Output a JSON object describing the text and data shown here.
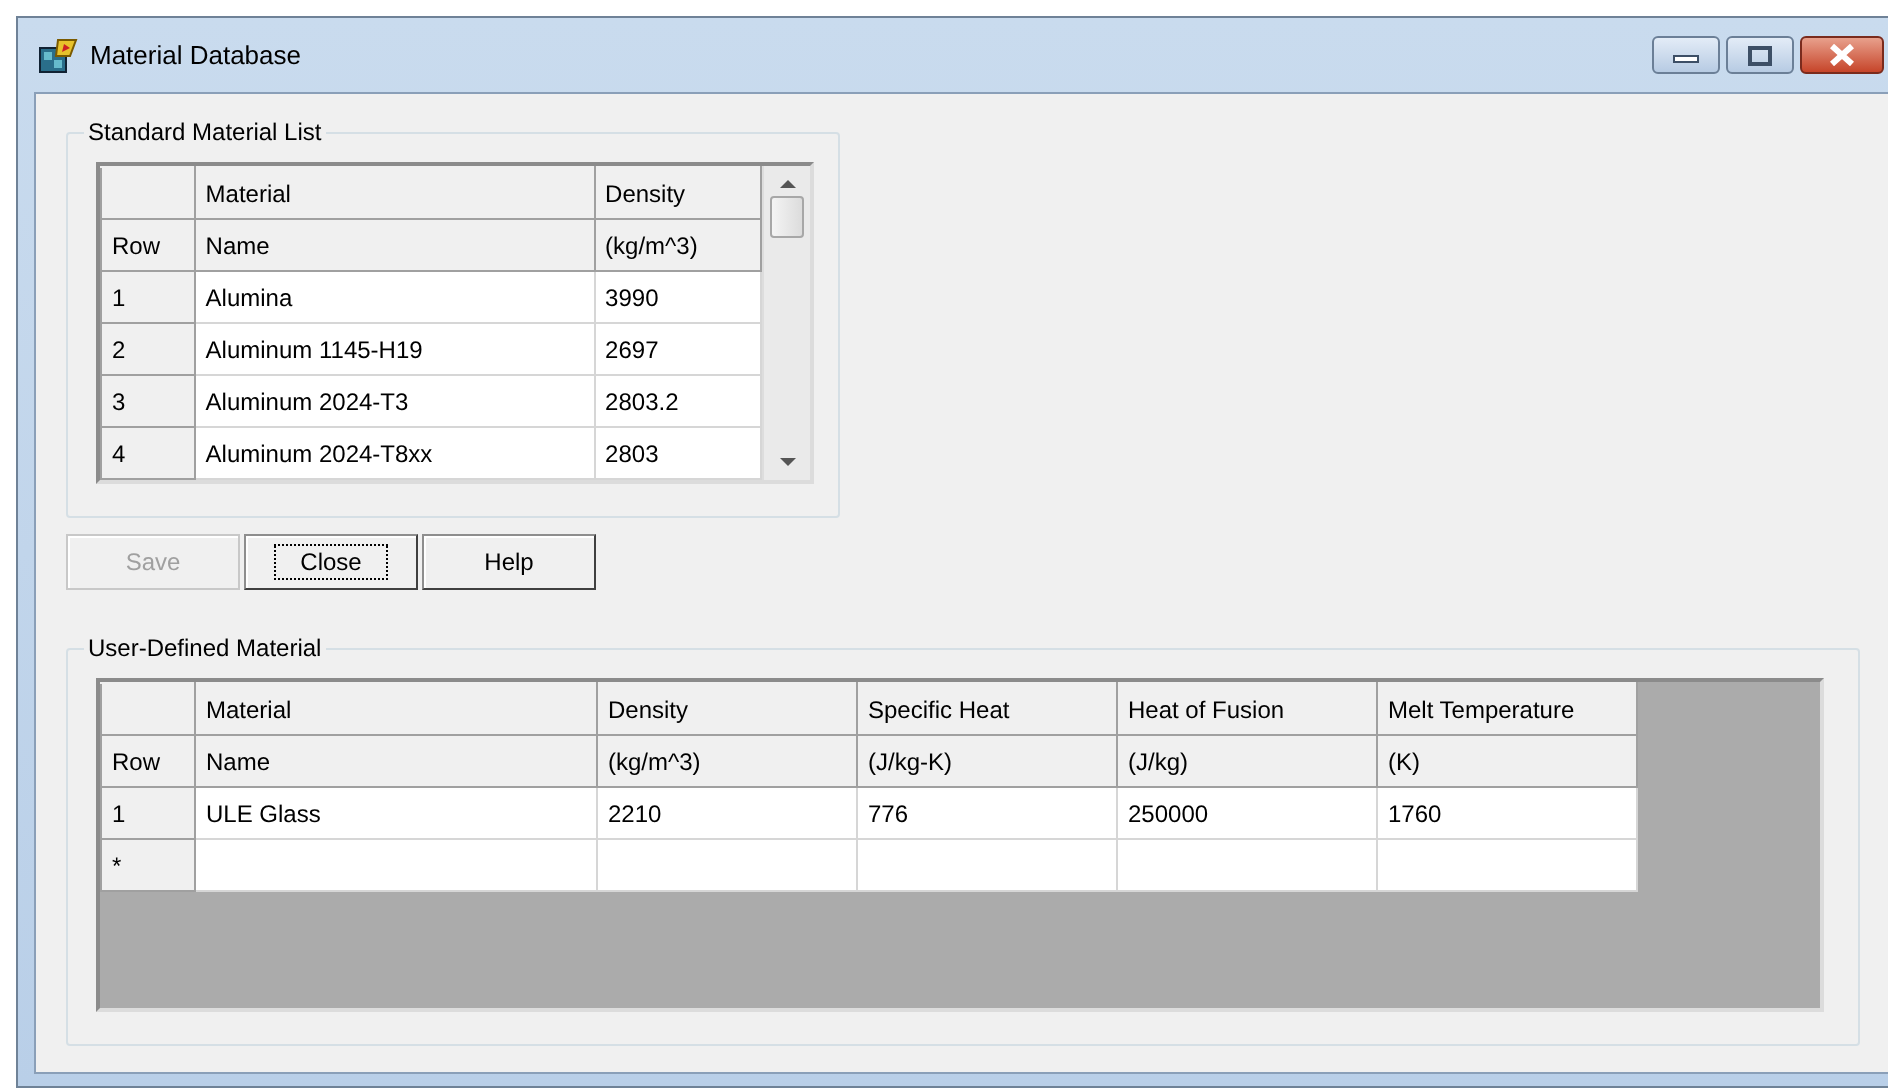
{
  "window": {
    "title": "Material Database"
  },
  "standard_list": {
    "legend": "Standard Material List",
    "header_rows": [
      [
        "",
        "Material",
        "Density"
      ],
      [
        "Row",
        "Name",
        "(kg/m^3)"
      ]
    ],
    "rows": [
      [
        "1",
        "Alumina",
        "3990"
      ],
      [
        "2",
        "Aluminum 1145-H19",
        "2697"
      ],
      [
        "3",
        "Aluminum 2024-T3",
        "2803.2"
      ],
      [
        "4",
        "Aluminum 2024-T8xx",
        "2803"
      ]
    ]
  },
  "buttons": [
    {
      "label": "Save",
      "disabled": true,
      "focused": false
    },
    {
      "label": "Close",
      "disabled": false,
      "focused": true
    },
    {
      "label": "Help",
      "disabled": false,
      "focused": false
    }
  ],
  "user_defined": {
    "legend": "User-Defined Material",
    "header_rows": [
      [
        "",
        "Material",
        "Density",
        "Specific Heat",
        "Heat of Fusion",
        "Melt Temperature"
      ],
      [
        "Row",
        "Name",
        "(kg/m^3)",
        "(J/kg-K)",
        "(J/kg)",
        "(K)"
      ]
    ],
    "rows": [
      [
        "1",
        "ULE Glass",
        "2210",
        "776",
        "250000",
        "1760"
      ]
    ],
    "new_row_marker": "*"
  }
}
